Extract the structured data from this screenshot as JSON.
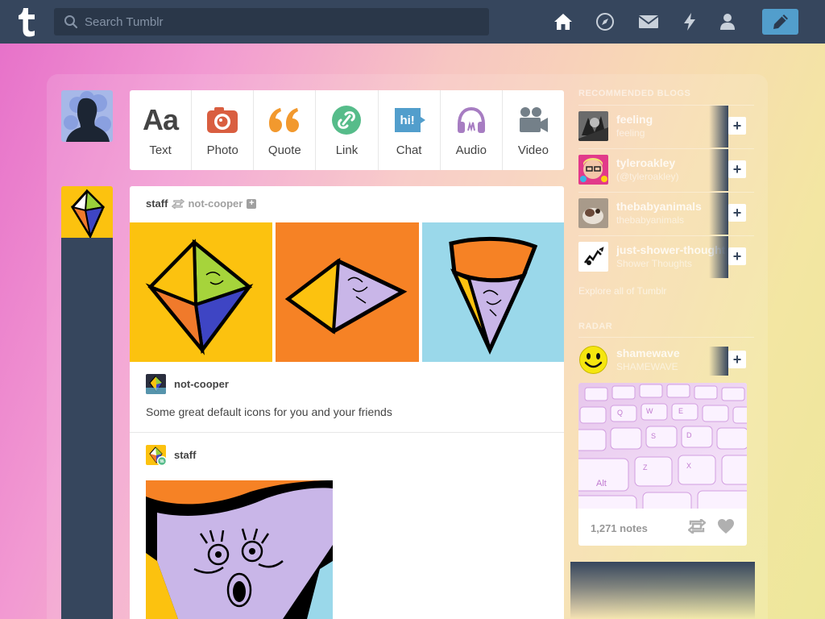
{
  "nav": {
    "search_placeholder": "Search Tumblr",
    "icons": [
      "home-icon",
      "explore-icon",
      "inbox-icon",
      "activity-icon",
      "account-icon",
      "compose-icon"
    ]
  },
  "post_types": [
    {
      "label": "Text",
      "glyph": "Aa",
      "color": "#444444"
    },
    {
      "label": "Photo",
      "color": "#d95e40"
    },
    {
      "label": "Quote",
      "glyph": "“",
      "color": "#f2992e"
    },
    {
      "label": "Link",
      "color": "#56bc8a"
    },
    {
      "label": "Chat",
      "glyph": "hi!",
      "color": "#529ecc"
    },
    {
      "label": "Audio",
      "color": "#a77dc2"
    },
    {
      "label": "Video",
      "color": "#748089"
    }
  ],
  "post": {
    "author": "staff",
    "reblogged_from": "not-cooper",
    "reblog_user": "not-cooper",
    "caption": "Some great default icons for you and your friends",
    "original_user": "staff"
  },
  "sidebar": {
    "recommended_title": "RECOMMENDED BLOGS",
    "blogs": [
      {
        "name": "feeling",
        "sub": "feeling"
      },
      {
        "name": "tyleroakley",
        "sub": "(@tyleroakley)"
      },
      {
        "name": "thebabyanimals",
        "sub": "thebabyanimals"
      },
      {
        "name": "just-shower-thoughts",
        "sub": "Shower Thoughts"
      }
    ],
    "explore_link": "Explore all of Tumblr",
    "radar_title": "RADAR",
    "radar": {
      "name": "shamewave",
      "sub": "SHAMEWAVE",
      "notes": "1,271 notes"
    }
  },
  "colors": {
    "navy": "#36465d",
    "compose_blue": "#529ecc"
  }
}
